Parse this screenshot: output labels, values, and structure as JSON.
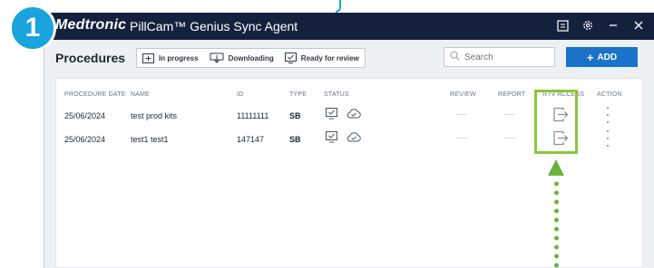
{
  "step_badge": "1",
  "titlebar": {
    "logo": "Medtronic",
    "app_title": "PillCam™ Genius Sync Agent",
    "icons": [
      "log-icon",
      "settings-icon",
      "minimize-icon",
      "close-icon"
    ]
  },
  "toolbar": {
    "page_title": "Procedures",
    "legend": [
      {
        "icon": "in-progress-icon",
        "label": "In progress"
      },
      {
        "icon": "downloading-icon",
        "label": "Downloading"
      },
      {
        "icon": "ready-for-review-icon",
        "label": "Ready for review"
      }
    ],
    "search_placeholder": "Search",
    "add_label": "ADD"
  },
  "table": {
    "columns": [
      "PROCEDURE DATE",
      "NAME",
      "ID",
      "TYPE",
      "STATUS",
      "REVIEW",
      "REPORT",
      "RTV ACCESS",
      "ACTION"
    ],
    "rows": [
      {
        "date": "25/06/2024",
        "name": "test prod kits",
        "id": "11111111",
        "type": "SB",
        "review": "----",
        "report": "----"
      },
      {
        "date": "25/06/2024",
        "name": "test1 test1",
        "id": "147147",
        "type": "SB",
        "review": "----",
        "report": "----"
      }
    ]
  },
  "colors": {
    "titlebar": "#14213d",
    "accent": "#1a72c9",
    "badge": "#1aa3dd",
    "highlight": "#8cc63f"
  }
}
